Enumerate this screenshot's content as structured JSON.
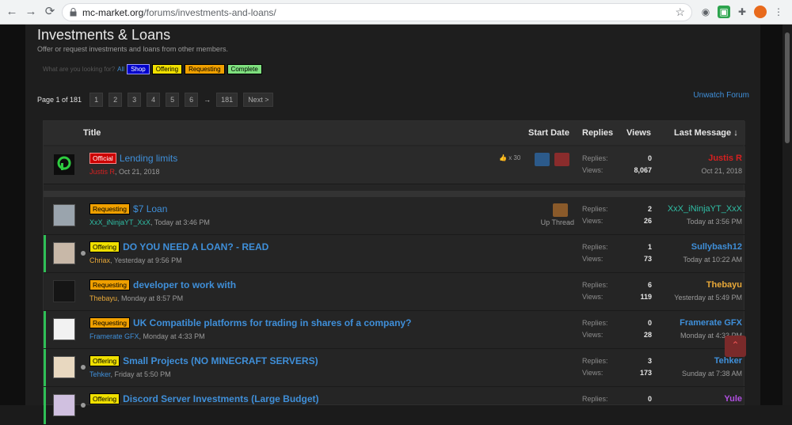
{
  "browser": {
    "url_host": "mc-market.org",
    "url_path": "/forums/investments-and-loans/",
    "back_icon": "arrow-left-icon",
    "forward_icon": "arrow-right-icon",
    "reload_icon": "reload-icon"
  },
  "forum": {
    "title": "Investments & Loans",
    "description": "Offer or request investments and loans from other members.",
    "filter_label": "What are you looking for?",
    "filter_all": "All",
    "filters": [
      "Shop",
      "Offering",
      "Requesting",
      "Complete"
    ],
    "unwatch": "Unwatch Forum"
  },
  "pager": {
    "label": "Page 1 of 181",
    "pages": [
      "1",
      "2",
      "3",
      "4",
      "5",
      "6"
    ],
    "arrow": "→",
    "last": "181",
    "next": "Next >"
  },
  "table": {
    "headers": {
      "title": "Title",
      "start_date": "Start Date",
      "replies": "Replies",
      "views": "Views",
      "last_message": "Last Message ↓"
    },
    "labels": {
      "replies": "Replies:",
      "views": "Views:"
    },
    "likes": "x 30",
    "up_thread": "Up Thread"
  },
  "threads": [
    {
      "prefix": "Official",
      "title": "Lending limits",
      "author": "Justis R",
      "date": "Oct 21, 2018",
      "replies": "0",
      "views": "8,067",
      "last_user": "Justis R",
      "last_date": "Oct 21, 2018"
    },
    {
      "prefix": "Requesting",
      "title": "$7 Loan",
      "author": "XxX_iNinjaYT_XxX",
      "date": "Today at 3:46 PM",
      "replies": "2",
      "views": "26",
      "last_user": "XxX_iNinjaYT_XxX",
      "last_date": "Today at 3:56 PM"
    },
    {
      "prefix": "Offering",
      "title": "DO YOU NEED A LOAN? - READ",
      "author": "Chriax",
      "date": "Yesterday at 9:56 PM",
      "replies": "1",
      "views": "73",
      "last_user": "Sullybash12",
      "last_date": "Today at 10:22 AM"
    },
    {
      "prefix": "Requesting",
      "title": "developer to work with",
      "author": "Thebayu",
      "date": "Monday at 8:57 PM",
      "replies": "6",
      "views": "119",
      "last_user": "Thebayu",
      "last_date": "Yesterday at 5:49 PM"
    },
    {
      "prefix": "Requesting",
      "title": "UK Compatible platforms for trading in shares of a company?",
      "author": "Framerate GFX",
      "date": "Monday at 4:33 PM",
      "replies": "0",
      "views": "28",
      "last_user": "Framerate GFX",
      "last_date": "Monday at 4:33 PM"
    },
    {
      "prefix": "Offering",
      "title": "Small Projects (NO MINECRAFT SERVERS)",
      "author": "Tehker",
      "date": "Friday at 5:50 PM",
      "replies": "3",
      "views": "173",
      "last_user": "Tehker",
      "last_date": "Sunday at 7:38 AM"
    },
    {
      "prefix": "Offering",
      "title": "Discord Server Investments (Large Budget)",
      "author": "",
      "date": "",
      "replies": "0",
      "views": "",
      "last_user": "Yule",
      "last_date": ""
    }
  ],
  "colors": {
    "link": "#3f8fd9",
    "offering": "#f0e000",
    "requesting": "#f0a000",
    "official": "#cc0000",
    "unread_bar": "#2fbf56"
  }
}
